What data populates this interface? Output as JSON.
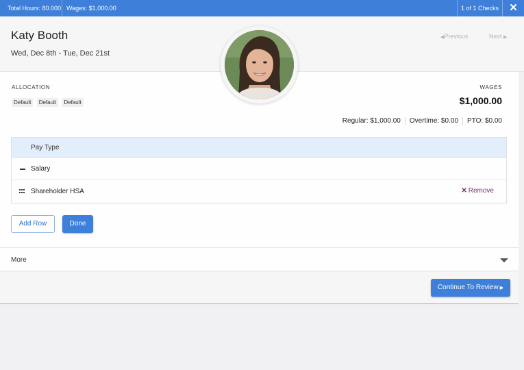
{
  "topbar": {
    "total_hours": "Total Hours: 80.000",
    "wages": "Wages: $1,000.00",
    "checks": "1 of 1 Checks",
    "close_icon": "close-icon"
  },
  "employee": {
    "name": "Katy Booth",
    "date_range": "Wed, Dec 8th - Tue, Dec 21st"
  },
  "nav": {
    "previous": "Previous",
    "next": "Next"
  },
  "allocation": {
    "label": "ALLOCATION",
    "chips": [
      "Default",
      "Default",
      "Default"
    ]
  },
  "wages": {
    "label": "WAGES",
    "total": "$1,000.00",
    "regular": "Regular: $1,000.00",
    "overtime": "Overtime: $0.00",
    "pto": "PTO: $0.00"
  },
  "table": {
    "header": "Pay Type",
    "rows": [
      {
        "label": "Salary",
        "icon": "dash-icon"
      },
      {
        "label": "Shareholder HSA",
        "icon": "drag-handle-icon",
        "action": "Remove"
      }
    ]
  },
  "actions": {
    "add_row": "Add Row",
    "done": "Done"
  },
  "more": {
    "label": "More",
    "icon": "chevron-down-icon"
  },
  "footer": {
    "continue": "Continue To Review"
  },
  "colors": {
    "primary": "#3d7fd9",
    "header_row": "#e2eefb",
    "remove": "#7a2d6e"
  }
}
